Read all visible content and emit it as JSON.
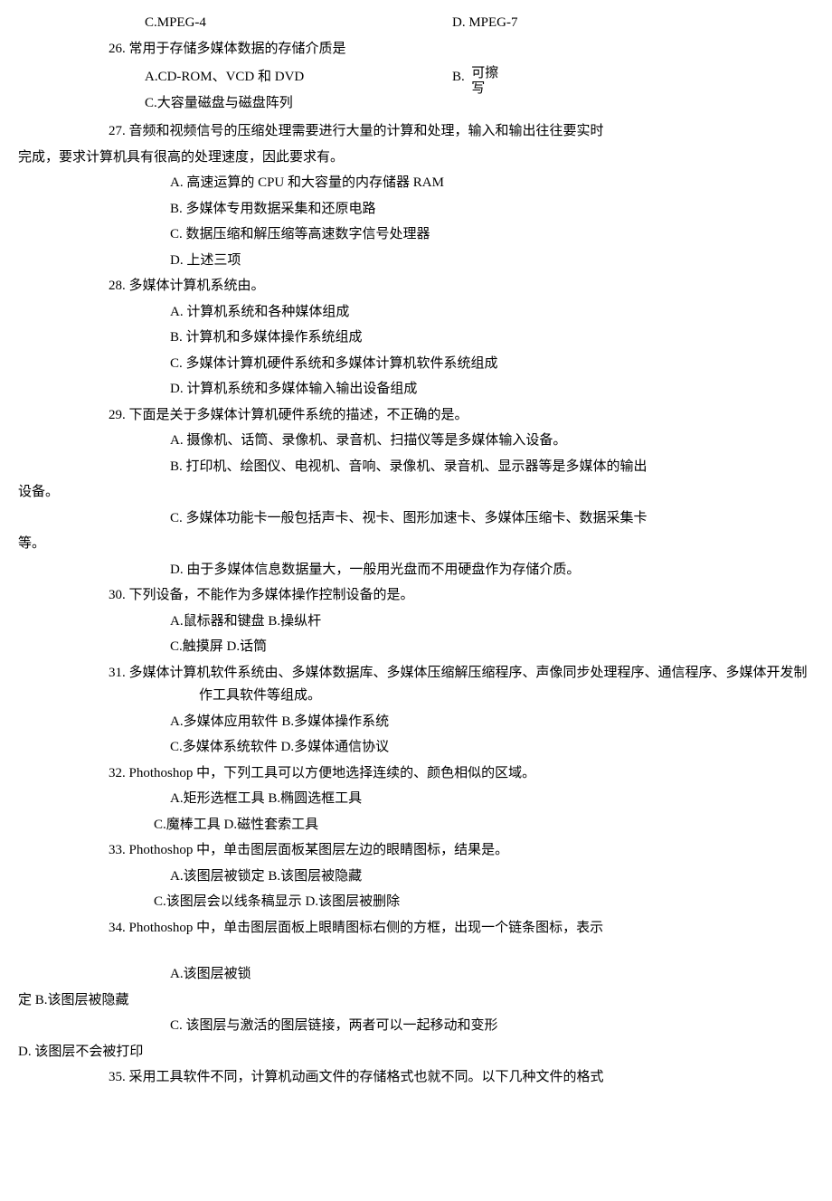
{
  "lines": {
    "l1a": "C.MPEG-4",
    "l1b": "D. MPEG-7",
    "q26": "26.  常用于存储多媒体数据的存储介质是",
    "q26a": "A.CD-ROM、VCD 和 DVD",
    "q26b": "B.  可擦写",
    "q26c": "C.大容量磁盘与磁盘阵列",
    "q27": "27.  音频和视频信号的压缩处理需要进行大量的计算和处理，输入和输出往往要实时",
    "q27cont": "完成，要求计算机具有很高的处理速度，因此要求有。",
    "q27a": "A.  高速运算的 CPU 和大容量的内存储器 RAM",
    "q27b": "B.  多媒体专用数据采集和还原电路",
    "q27c": "C.  数据压缩和解压缩等高速数字信号处理器",
    "q27d": "D.  上述三项",
    "q28": "28.  多媒体计算机系统由。",
    "q28a": "A.  计算机系统和各种媒体组成",
    "q28b": "B.  计算机和多媒体操作系统组成",
    "q28c": "C.  多媒体计算机硬件系统和多媒体计算机软件系统组成",
    "q28d": "D.  计算机系统和多媒体输入输出设备组成",
    "q29": "29.  下面是关于多媒体计算机硬件系统的描述，不正确的是。",
    "q29a": "A.  摄像机、话筒、录像机、录音机、扫描仪等是多媒体输入设备。",
    "q29b": "B.  打印机、绘图仪、电视机、音响、录像机、录音机、显示器等是多媒体的输出",
    "q29b2": "设备。",
    "q29c": "C.  多媒体功能卡一般包括声卡、视卡、图形加速卡、多媒体压缩卡、数据采集卡",
    "q29c2": "等。",
    "q29d": "D.  由于多媒体信息数据量大，一般用光盘而不用硬盘作为存储介质。",
    "q30": "30.  下列设备，不能作为多媒体操作控制设备的是。",
    "q30a": "A.鼠标器和键盘 B.操纵杆",
    "q30c": "C.触摸屏 D.话筒",
    "q31": "31.  多媒体计算机软件系统由、多媒体数据库、多媒体压缩解压缩程序、声像同步处理程序、通信程序、多媒体开发制作工具软件等组成。",
    "q31a": "A.多媒体应用软件 B.多媒体操作系统",
    "q31c": "C.多媒体系统软件 D.多媒体通信协议",
    "q32": "32.  Phothoshop 中，下列工具可以方便地选择连续的、颜色相似的区域。",
    "q32a": "A.矩形选框工具 B.椭圆选框工具",
    "q32c": "C.魔棒工具 D.磁性套索工具",
    "q33": "33.  Phothoshop 中，单击图层面板某图层左边的眼睛图标，结果是。",
    "q33a": "A.该图层被锁定 B.该图层被隐藏",
    "q33c": "C.该图层会以线条稿显示 D.该图层被删除",
    "q34": "34.  Phothoshop 中，单击图层面板上眼睛图标右侧的方框，出现一个链条图标，表示",
    "q34a1": "A.该图层被锁",
    "q34a2": "定 B.该图层被隐藏",
    "q34c": "C.  该图层与激活的图层链接，两者可以一起移动和变形",
    "q34d": "D.  该图层不会被打印",
    "q35": "35.  采用工具软件不同，计算机动画文件的存储格式也就不同。以下几种文件的格式"
  }
}
